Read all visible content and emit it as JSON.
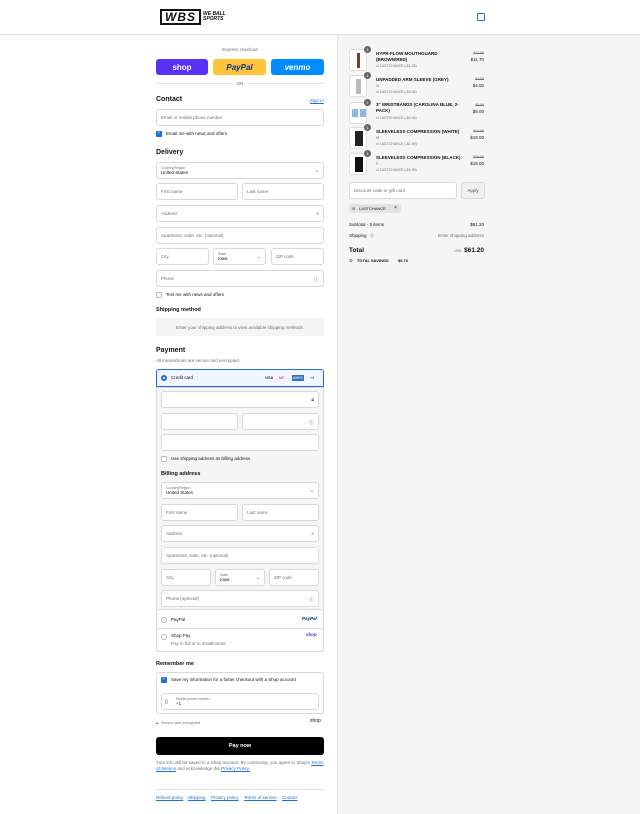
{
  "header": {
    "logo_box": "WBS",
    "logo_text": "WE BALL SPORTS",
    "cart_icon": "bag-icon"
  },
  "express": {
    "label": "Express checkout",
    "or": "OR",
    "shop": "shop",
    "paypal": "PayPal",
    "venmo": "venmo"
  },
  "contact": {
    "title": "Contact",
    "sign_in": "Sign in",
    "placeholder": "Email or mobile phone number",
    "news": "Email me with news and offers"
  },
  "delivery": {
    "title": "Delivery",
    "country_label": "Country/Region",
    "country": "United States",
    "first": "First name",
    "last": "Last name",
    "address": "Address",
    "apt": "Apartment, suite, etc. (optional)",
    "city": "City",
    "state_label": "State",
    "state": "Iowa",
    "zip": "ZIP code",
    "phone": "Phone",
    "text_me": "Text me with news and offers"
  },
  "shipping": {
    "title": "Shipping method",
    "note": "Enter your shipping address to view available shipping methods."
  },
  "payment": {
    "title": "Payment",
    "sub": "All transactions are secure and encrypted.",
    "card": "Credit card",
    "card_brands": [
      "VISA",
      "MC",
      "AMEX",
      "+4"
    ],
    "use_shipping": "Use shipping address as billing address",
    "billing_title": "Billing address",
    "country_label": "Country/Region",
    "country": "United States",
    "first": "First name",
    "last": "Last name",
    "address": "Address",
    "apt": "Apartment, suite, etc. (optional)",
    "city": "City",
    "state_label": "State",
    "state": "Iowa",
    "zip": "ZIP code",
    "phone": "Phone (optional)",
    "paypal": "PayPal",
    "paypal_logo": "PayPal",
    "shoppay": "Shop Pay",
    "shoppay_sub": "Pay in full or in installments",
    "shop_logo": "shop"
  },
  "remember": {
    "title": "Remember me",
    "save": "Save my information for a faster checkout with a Shop account",
    "mobile_label": "Mobile phone number",
    "mobile": "+1",
    "secure": "Secure and encrypted",
    "shop": "shop"
  },
  "pay": {
    "button": "Pay now",
    "terms1": "Your info will be saved to a Shop account. By continuing, you agree to Shop's",
    "tos": "Terms of Service",
    "terms2": "and acknowledge the",
    "privacy": "Privacy Policy."
  },
  "footer": [
    "Refund policy",
    "Shipping",
    "Privacy policy",
    "Terms of service",
    "Contact"
  ],
  "cart": {
    "items": [
      {
        "qty": "1",
        "name": "HYPR-FLOW MOUTHGUARD (BROWN/RED)",
        "variant": "",
        "discount": "LASTCHANCE (-$1.25)",
        "old": "$12.95",
        "price": "$11.70"
      },
      {
        "qty": "1",
        "name": "UNPADDED ARM SLEEVE (GREY)",
        "variant": "XL",
        "discount": "LASTCHANCE (-$0.45)",
        "old": "$4.95",
        "price": "$4.50"
      },
      {
        "qty": "1",
        "name": "3\" WRISTBANDS (CAROLINA BLUE, 2-PACK)",
        "variant": "",
        "discount": "LASTCHANCE (-$0.99)",
        "old": "$9.99",
        "price": "$9.00"
      },
      {
        "qty": "1",
        "name": "SLEEVELESS COMPRESSION (WHITE)",
        "variant": "M",
        "discount": "LASTCHANCE (-$1.99)",
        "old": "$19.99",
        "price": "$18.00"
      },
      {
        "qty": "1",
        "name": "SLEEVELESS COMPRESSION (BLACK)",
        "variant": "S",
        "discount": "LASTCHANCE (-$1.99)",
        "old": "$19.99",
        "price": "$18.00"
      }
    ],
    "discount_placeholder": "Discount code or gift card",
    "apply": "Apply",
    "code": "LASTCHANCE",
    "subtotal_label": "Subtotal · 5 items",
    "subtotal": "$61.20",
    "shipping_label": "Shipping",
    "shipping": "Enter shipping address",
    "total_label": "Total",
    "currency": "USD",
    "total": "$61.20",
    "savings_label": "TOTAL SAVINGS",
    "savings": "$6.76"
  }
}
